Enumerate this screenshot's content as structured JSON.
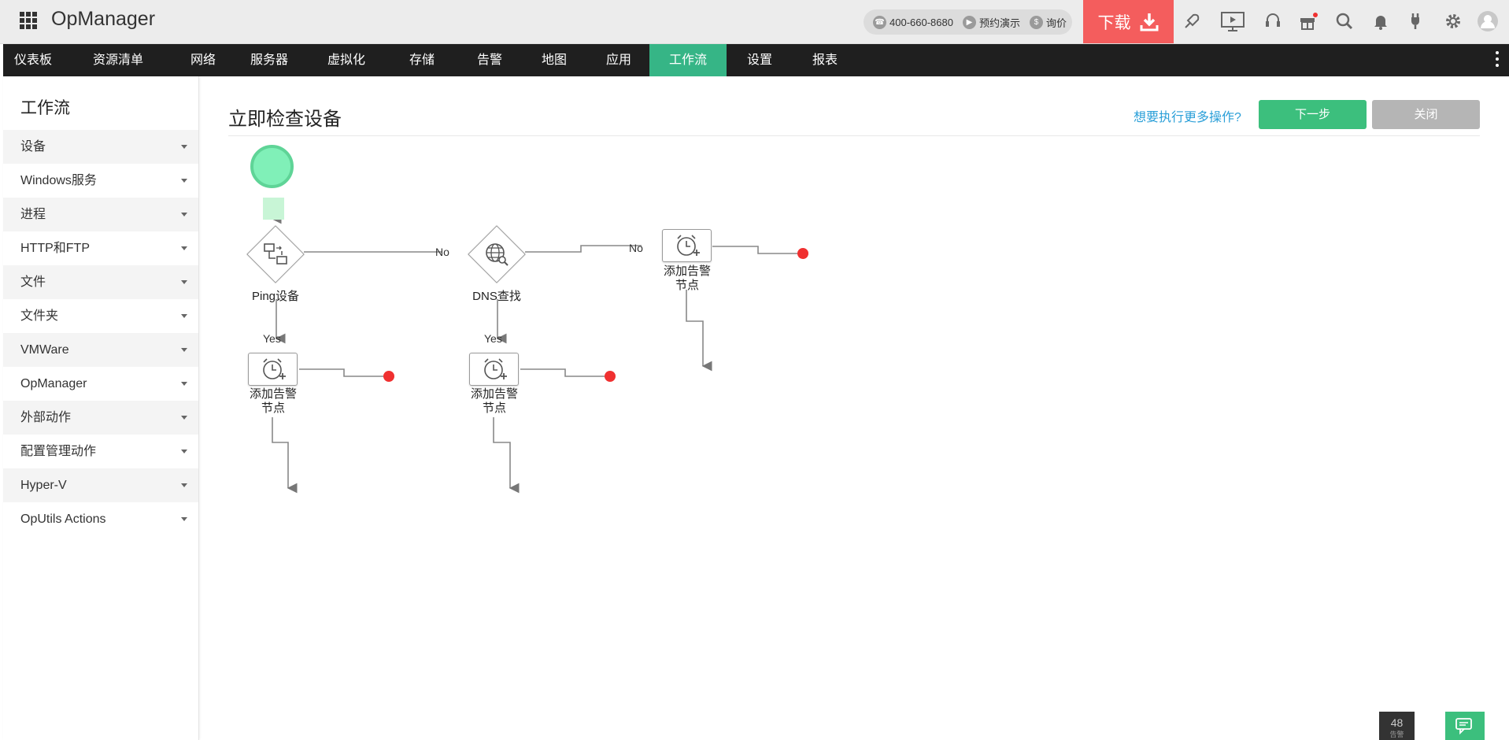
{
  "app": {
    "title": "OpManager"
  },
  "header": {
    "phone": "400-660-8680",
    "demo": "预约演示",
    "price": "询价",
    "download": "下载"
  },
  "nav": {
    "items": [
      "仪表板",
      "资源清单",
      "网络",
      "服务器",
      "虚拟化",
      "存储",
      "告警",
      "地图",
      "应用",
      "工作流",
      "设置",
      "报表"
    ],
    "active": "工作流"
  },
  "sidebar": {
    "title": "工作流",
    "items": [
      "设备",
      "Windows服务",
      "进程",
      "HTTP和FTP",
      "文件",
      "文件夹",
      "VMWare",
      "OpManager",
      "外部动作",
      "配置管理动作",
      "Hyper-V",
      "OpUtils Actions"
    ]
  },
  "main": {
    "title": "立即检查设备",
    "more_link": "想要执行更多操作?",
    "next_label": "下一步",
    "close_label": "关闭"
  },
  "workflow": {
    "nodes": {
      "ping": "Ping设备",
      "dns": "DNS查找",
      "alarm_dns_no_1": "添加告警",
      "alarm_dns_no_2": "节点",
      "alarm_ping_yes_1": "添加告警",
      "alarm_ping_yes_2": "节点",
      "alarm_dns_yes_1": "添加告警",
      "alarm_dns_yes_2": "节点"
    },
    "edges": {
      "ping_no": "No",
      "dns_no": "No",
      "ping_yes": "Yes",
      "dns_yes": "Yes"
    }
  },
  "footer": {
    "alarm_count": "48",
    "alarm_label": "告警"
  },
  "colors": {
    "accent": "#3cbf7d",
    "download": "#f45d5d",
    "nav_bg": "#1f1f1f",
    "link": "#2a9fd8",
    "end_dot": "#f03030"
  }
}
